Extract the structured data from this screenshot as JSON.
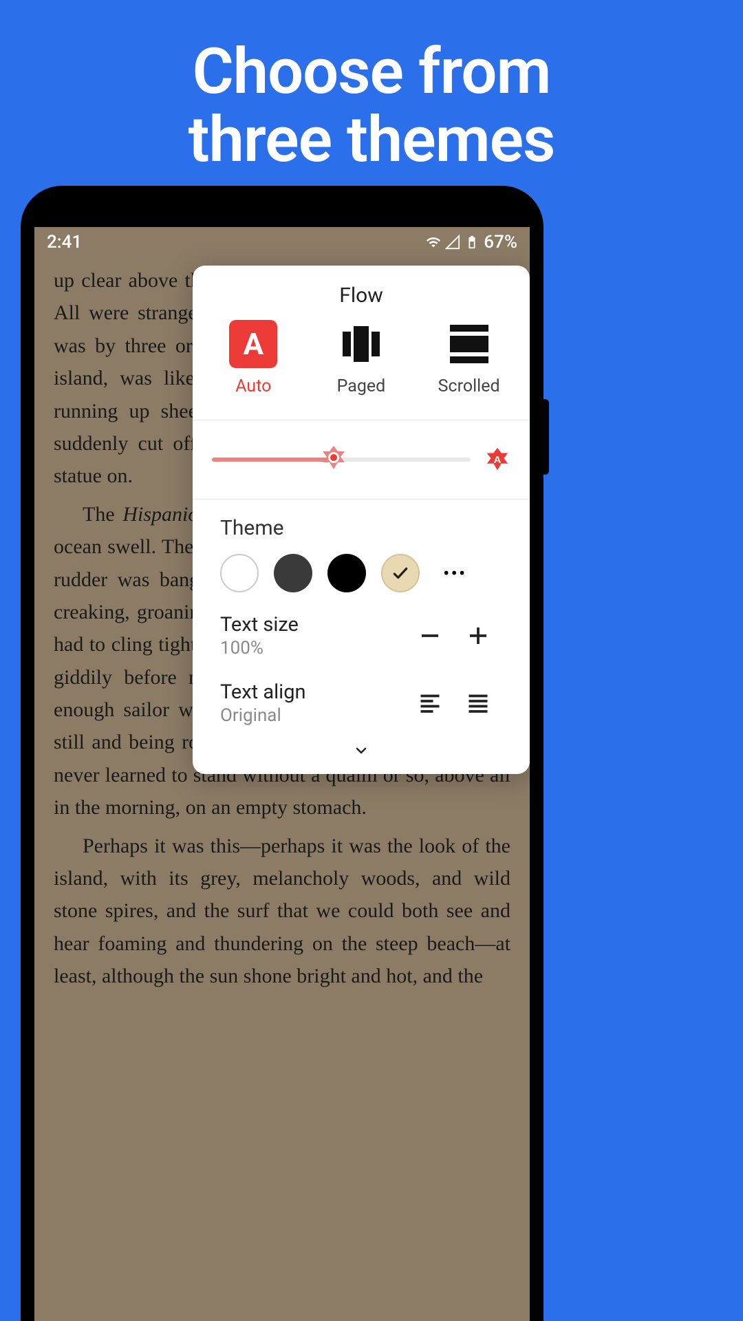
{
  "hero": {
    "line1": "Choose from",
    "line2": "three themes"
  },
  "status": {
    "time": "2:41",
    "battery": "67%"
  },
  "reader": {
    "p1": "up clear above the vegetation in spires of naked rock. All were strangely shaped, and the Spy-glass, which was by three or four hundred feet the tallest on the island, was likewise the strangest in configuration, running up sheer from almost every side and then suddenly cut off at the top like a pedestal to put a statue on.",
    "p2_pre": "The ",
    "p2_em": "Hispaniola",
    "p2_post": " was rolling scuppers under in the ocean swell. The booms were tearing at the blocks, the rudder was banging to and fro, and the whole ship creaking, groaning, and jumping like a manufactory. I had to cling tight to the backstay, and the world turned giddily before my eyes, for though I was a good enough sailor when there was way on, this standing still and being rolled about like a bottle was a thing I never learned to stand without a qualm or so, above all in the morning, on an empty stomach.",
    "p3": "Perhaps it was this—perhaps it was the look of the island, with its grey, melancholy woods, and wild stone spires, and the surf that we could both see and hear foaming and thundering on the steep beach—at least, although the sun shone bright and hot, and the"
  },
  "popover": {
    "title": "Flow",
    "flow": {
      "auto": "Auto",
      "paged": "Paged",
      "scrolled": "Scrolled"
    },
    "theme_label": "Theme",
    "text_size": {
      "label": "Text size",
      "value": "100%"
    },
    "text_align": {
      "label": "Text align",
      "value": "Original"
    }
  },
  "icons": {
    "auto_letter": "A"
  }
}
